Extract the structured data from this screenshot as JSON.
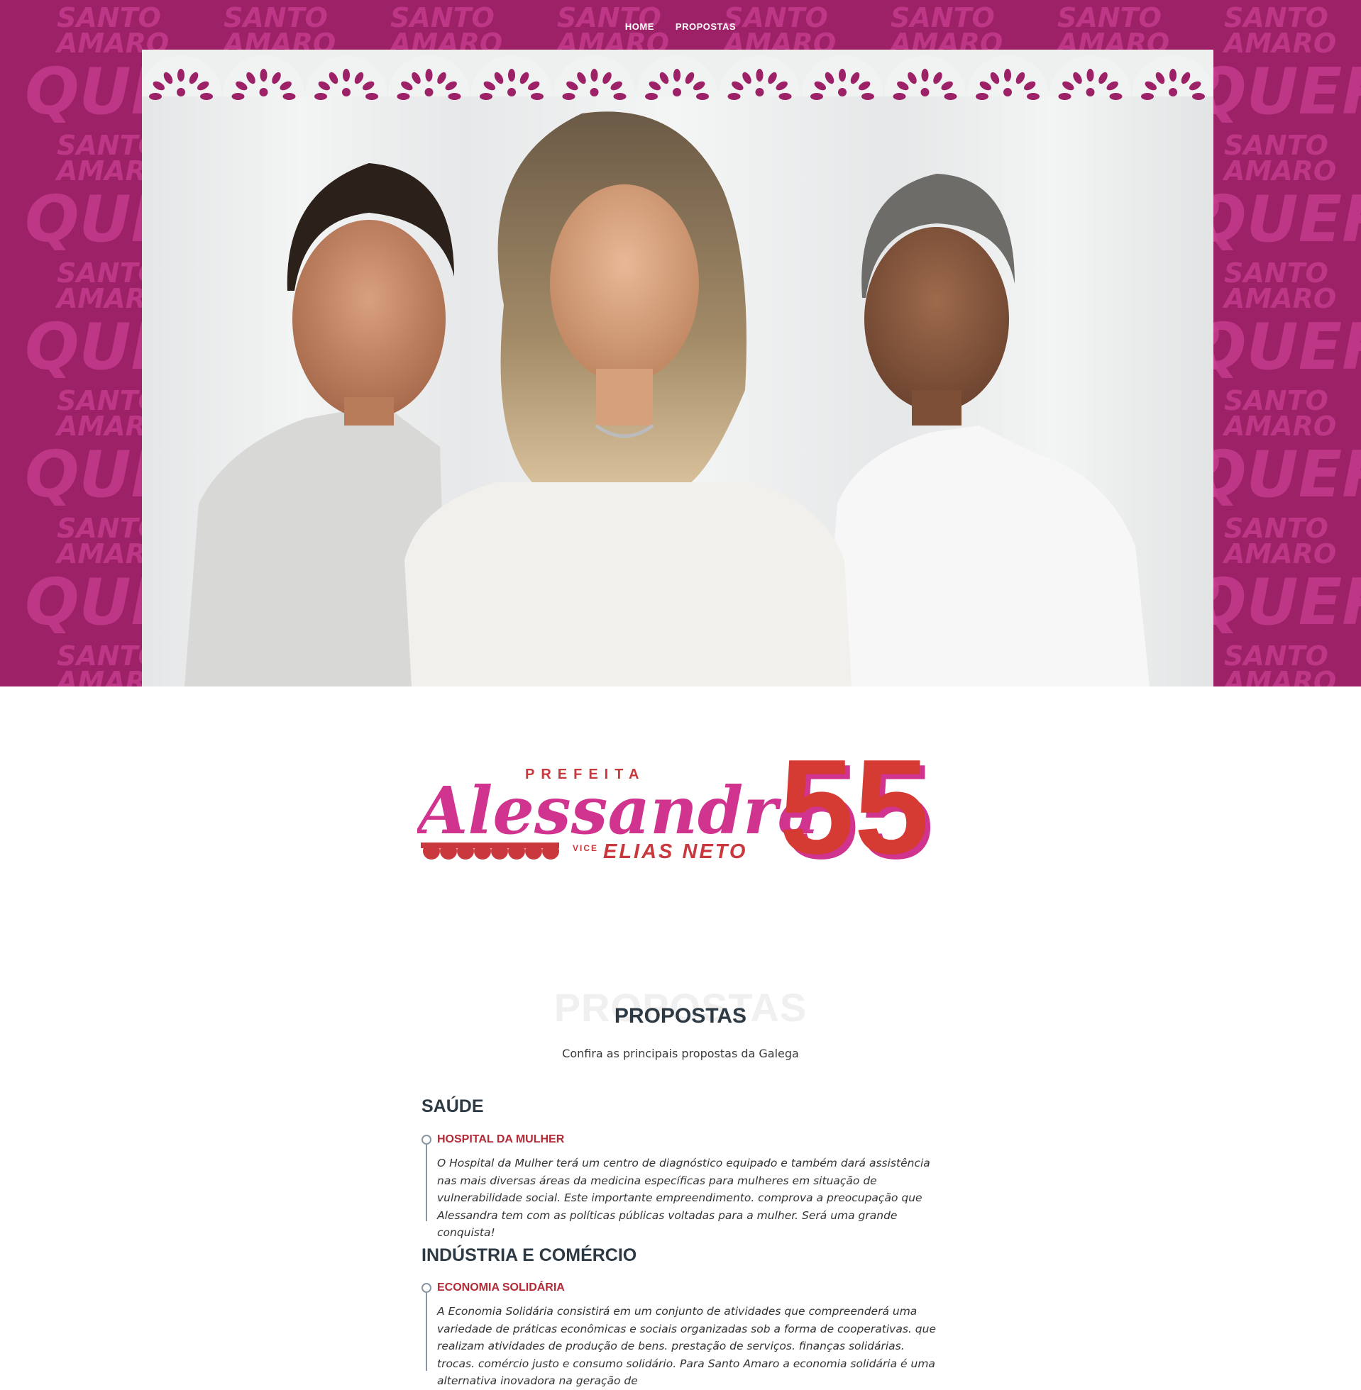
{
  "nav": {
    "home": "HOME",
    "propostas": "PROPOSTAS"
  },
  "hero": {
    "pattern_text_top": "SANTO",
    "pattern_text_mid": "AMARO",
    "pattern_text_big": "QUER",
    "bg_color": "#9c2166",
    "pattern_color": "#c73a8e"
  },
  "logo": {
    "prefeita": "PREFEITA",
    "name": "Alessandra",
    "vice_label": "VICE",
    "vice_name": "ELIAS NETO",
    "number": "55"
  },
  "section": {
    "bg_title": "PROPOSTAS",
    "title": "PROPOSTAS",
    "subtitle": "Confira as principais propostas da Galega"
  },
  "categories": [
    {
      "name": "SAÚDE",
      "items": [
        {
          "title": "HOSPITAL DA MULHER",
          "text": "O Hospital da Mulher terá um centro de diagnóstico equipado e também dará assistência nas mais diversas áreas da medicina específicas para mulheres em situação de vulnerabilidade social. Este importante empreendimento. comprova a preocupação que Alessandra tem com as políticas públicas voltadas para a mulher. Será uma grande conquista!"
        }
      ]
    },
    {
      "name": "INDÚSTRIA E COMÉRCIO",
      "items": [
        {
          "title": "ECONOMIA SOLIDÁRIA",
          "text": "A Economia Solidária consistirá em um conjunto de atividades que compreenderá uma variedade de práticas econômicas e sociais organizadas sob a forma de cooperativas. que realizam atividades de produção de bens. prestação de serviços. finanças solidárias. trocas. comércio justo e consumo solidário. Para Santo Amaro a economia solidária é uma alternativa inovadora na geração de"
        }
      ]
    }
  ]
}
